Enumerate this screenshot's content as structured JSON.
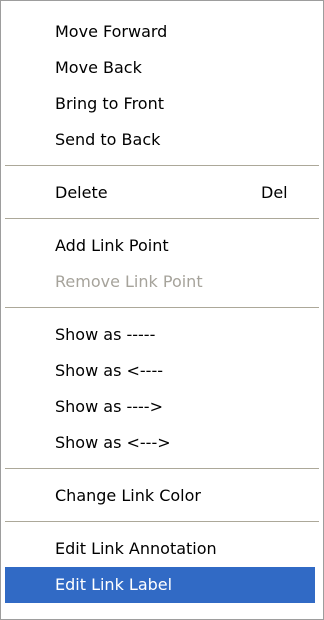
{
  "menu": {
    "items": [
      {
        "label": "Move Forward"
      },
      {
        "label": "Move Back"
      },
      {
        "label": "Bring to Front"
      },
      {
        "label": "Send to Back"
      },
      {
        "label": "Delete",
        "shortcut": "Del"
      },
      {
        "label": "Add Link Point"
      },
      {
        "label": "Remove Link Point",
        "state": "disabled"
      },
      {
        "label": "Show as -----"
      },
      {
        "label": "Show as <----"
      },
      {
        "label": "Show as ---->"
      },
      {
        "label": "Show as <--->"
      },
      {
        "label": "Change Link Color"
      },
      {
        "label": "Edit Link Annotation"
      },
      {
        "label": "Edit Link Label",
        "state": "highlighted"
      }
    ]
  },
  "colors": {
    "highlight_background": "#316ac5",
    "highlight_text": "#ffffff",
    "disabled_text": "#a6a39b",
    "separator": "#aca899"
  }
}
